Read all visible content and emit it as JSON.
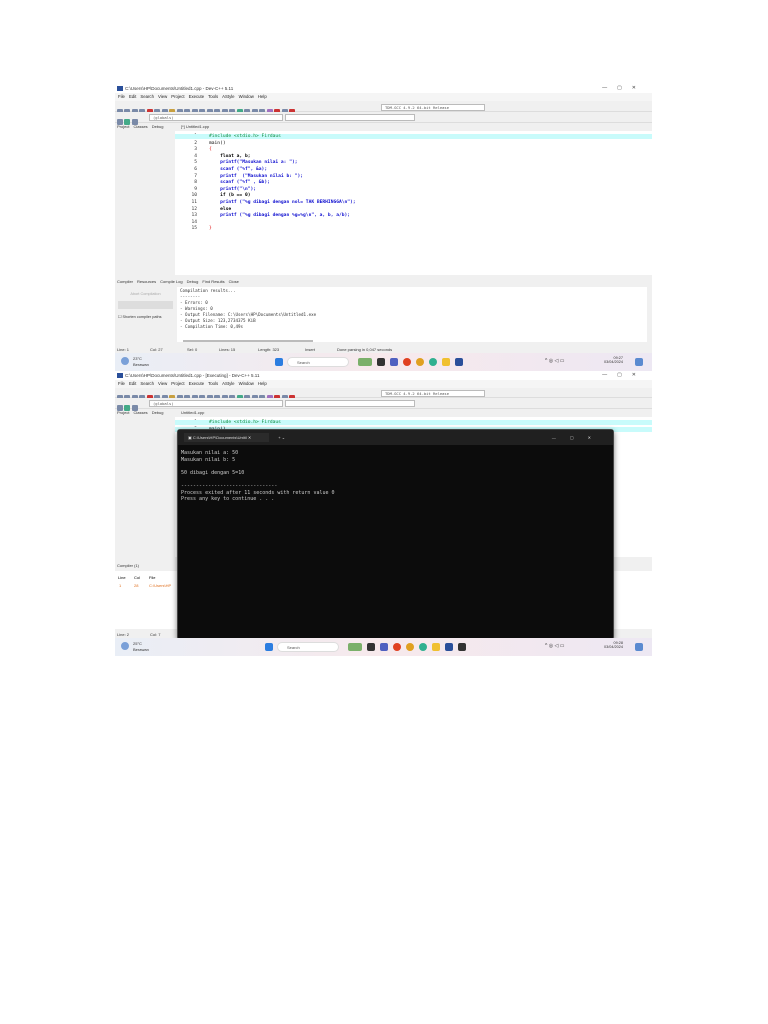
{
  "shot1": {
    "title": "C:\\Users\\HP\\Documents\\Untitled1.cpp - Dev-C++ 5.11",
    "menu": [
      "File",
      "Edit",
      "Search",
      "View",
      "Project",
      "Execute",
      "Tools",
      "AStyle",
      "Window",
      "Help"
    ],
    "compiler_combo": "TDM-GCC 4.9.2 64-bit Release",
    "scope_combo": "(globals)",
    "side_tabs": [
      "Project",
      "Classes",
      "Debug"
    ],
    "file_tab": "[*] Untitled1.cpp",
    "code": [
      {
        "n": "1",
        "t": "#include <stdio.h> Firdaus"
      },
      {
        "n": "2",
        "t": "main()"
      },
      {
        "n": "3",
        "t": "{"
      },
      {
        "n": "4",
        "t": "    float a, b;"
      },
      {
        "n": "5",
        "t": "    printf(\"Masukan nilai a: \");"
      },
      {
        "n": "6",
        "t": "    scanf (\"%f\", &a);"
      },
      {
        "n": "7",
        "t": "    printf  (\"Masukan nilai b: \");"
      },
      {
        "n": "8",
        "t": "    scanf (\"%f\" , &b);"
      },
      {
        "n": "9",
        "t": "    printf(\"\\n\");"
      },
      {
        "n": "10",
        "t": "    if (b == 0)"
      },
      {
        "n": "11",
        "t": "    printf (\"%g dibagi dengan nol= TAK BERHINGGA\\n\");"
      },
      {
        "n": "12",
        "t": "    else"
      },
      {
        "n": "13",
        "t": "    printf (\"%g dibagi dengan %g=%g\\n\", a, b, a/b);"
      },
      {
        "n": "14",
        "t": ""
      },
      {
        "n": "15",
        "t": "}"
      }
    ],
    "bottom_tabs": [
      "Compiler",
      "Resources",
      "Compile Log",
      "Debug",
      "Find Results",
      "Close"
    ],
    "abort_button": "Abort Compilation",
    "shorten_label": "Shorten compiler paths",
    "log": "Compilation results...\n--------\n- Errors: 0\n- Warnings: 0\n- Output Filename: C:\\Users\\HP\\Documents\\Untitled1.exe\n- Output Size: 123,2734375 KiB\n- Compilation Time: 0,49s",
    "status": {
      "line": "Line:   1",
      "col": "Col:   27",
      "sel": "Sel:   0",
      "lines": "Lines:   15",
      "length": "Length:   323",
      "mode": "Insert",
      "msg": "Done parsing in 0,047 seconds"
    },
    "taskbar": {
      "temp": "23°C",
      "weather": "Berawan",
      "search": "Search",
      "time": "09:27",
      "date": "03/04/2024"
    }
  },
  "shot2": {
    "title": "C:\\Users\\HP\\Documents\\Untitled1.cpp - [Executing] - Dev-C++ 5.11",
    "file_tab": "Untitled1.cpp",
    "code": [
      {
        "n": "1",
        "t": "#include <stdio.h> Firdaus"
      },
      {
        "n": "2",
        "t": "main()"
      }
    ],
    "console": {
      "tab_title": "C:\\Users\\HP\\Documents\\Untitl",
      "lines": [
        "Masukan nilai a: 50",
        "Masukan nilai b: 5",
        "",
        "50 dibagi dengan 5=10",
        "",
        "--------------------------------",
        "Process exited after 11 seconds with return value 0",
        "Press any key to continue . . ."
      ]
    },
    "bottom_tab": "Compiler (1)",
    "cols": [
      "Line",
      "Col",
      "File"
    ],
    "row": [
      "1",
      "28",
      "C:\\Users\\HP"
    ],
    "status": {
      "line": "Line:   2",
      "col": "Col:   7"
    },
    "taskbar": {
      "temp": "25°C",
      "weather": "Berawan",
      "search": "Search",
      "time": "09:28",
      "date": "03/04/2024"
    }
  }
}
